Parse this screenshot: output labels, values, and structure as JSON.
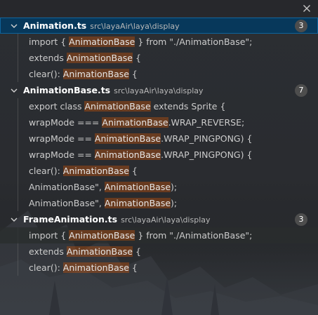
{
  "close_label": "✕",
  "files": [
    {
      "name": "Animation.ts",
      "path": "src\\layaAir\\laya\\display",
      "count": "3",
      "matches": [
        {
          "before": "import { ",
          "match": "AnimationBase",
          "after": " } from \"./AnimationBase\";"
        },
        {
          "before": "extends ",
          "match": "AnimationBase",
          "after": " {"
        },
        {
          "before": "clear(): ",
          "match": "AnimationBase",
          "after": " {"
        }
      ]
    },
    {
      "name": "AnimationBase.ts",
      "path": "src\\layaAir\\laya\\display",
      "count": "7",
      "matches": [
        {
          "before": "export class ",
          "match": "AnimationBase",
          "after": " extends Sprite {"
        },
        {
          "before": "wrapMode === ",
          "match": "AnimationBase",
          "after": ".WRAP_REVERSE;"
        },
        {
          "before": "wrapMode == ",
          "match": "AnimationBase",
          "after": ".WRAP_PINGPONG) {"
        },
        {
          "before": "wrapMode == ",
          "match": "AnimationBase",
          "after": ".WRAP_PINGPONG) {"
        },
        {
          "before": "clear(): ",
          "match": "AnimationBase",
          "after": " {"
        },
        {
          "before": "AnimationBase\", ",
          "match": "AnimationBase",
          "after": ");"
        },
        {
          "before": "AnimationBase\", ",
          "match": "AnimationBase",
          "after": ");"
        }
      ]
    },
    {
      "name": "FrameAnimation.ts",
      "path": "src\\layaAir\\laya\\display",
      "count": "3",
      "matches": [
        {
          "before": "import { ",
          "match": "AnimationBase",
          "after": " } from \"./AnimationBase\";"
        },
        {
          "before": "extends ",
          "match": "AnimationBase",
          "after": " {"
        },
        {
          "before": "clear(): ",
          "match": "AnimationBase",
          "after": " {"
        }
      ]
    }
  ]
}
